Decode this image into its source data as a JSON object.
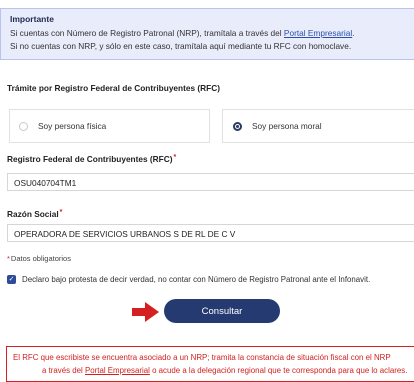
{
  "info": {
    "title": "Importante",
    "line1_text": "Si cuentas con Número de Registro Patronal (NRP), tramítala a través del ",
    "line1_link": "Portal Empresarial",
    "line1_end": ".",
    "line2": "Si no cuentas con NRP, y sólo en este caso, tramítala aquí mediante tu RFC con homoclave."
  },
  "tramite_label": "Trámite por Registro Federal de Contribuyentes (RFC)",
  "persona_options": [
    {
      "label": "Soy persona física",
      "selected": false
    },
    {
      "label": "Soy persona moral",
      "selected": true
    }
  ],
  "rfc": {
    "label": "Registro Federal de Contribuyentes (RFC)",
    "required_mark": "*",
    "value": "OSU040704TM1"
  },
  "razon_social": {
    "label": "Razón Social",
    "required_mark": "*",
    "value": "OPERADORA DE SERVICIOS URBANOS S DE RL DE C V"
  },
  "hint": {
    "mark": "*",
    "text": "Datos obligatorios"
  },
  "declaration": {
    "checked": true,
    "text": "Declaro bajo protesta de decir verdad, no contar con Número de Registro Patronal ante el Infonavit."
  },
  "submit_label": "Consultar",
  "error": {
    "line1": "El RFC que escribiste se encuentra asociado a un NRP; tramita la constancia de situación fiscal con el NRP",
    "line2_start": "a través del ",
    "line2_link": "Portal Empresarial",
    "line2_end": " o acude a la delegación regional que te corresponda para que lo aclares."
  },
  "colors": {
    "primary": "#253a71",
    "error": "#d21f1f",
    "arrow": "#d42020",
    "info_bg": "#e9ecfb"
  }
}
